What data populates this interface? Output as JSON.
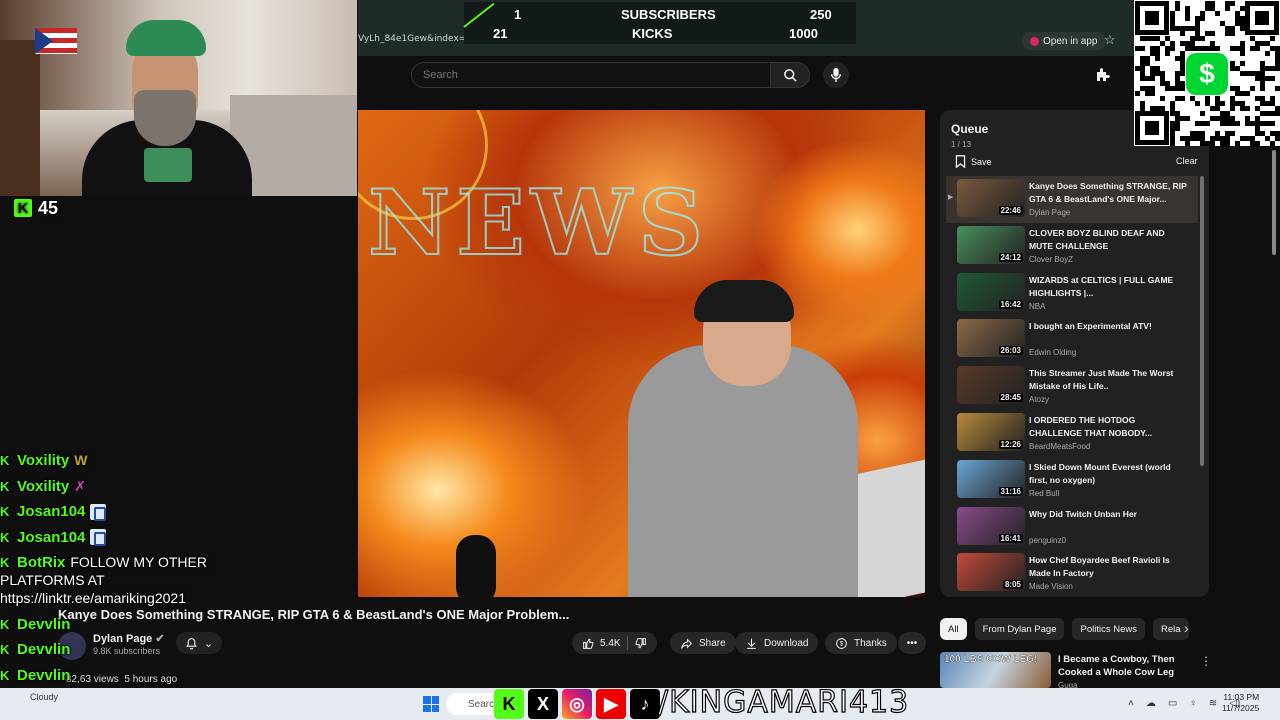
{
  "browser": {
    "url_fragment": "VyLh_84e1Gew&index=1",
    "open_in_app": "Open in app"
  },
  "scoreboard": {
    "row1": {
      "left": "1",
      "label": "SUBSCRIBERS",
      "right": "250"
    },
    "row2": {
      "left": "21",
      "label": "KICKS",
      "right": "1000"
    },
    "accent": "#53fc18"
  },
  "youtube": {
    "search_placeholder": "Search",
    "video_title": "Kanye Does Something STRANGE, RIP GTA 6 & BeastLand's ONE Major Problem...",
    "channel": "Dylan Page",
    "subscribers": "9.8K subscribers",
    "views": "82,63 views",
    "ago": "5 hours ago",
    "actions": {
      "likes": "5.4K",
      "share": "Share",
      "download": "Download",
      "thanks": "Thanks"
    },
    "queue": {
      "title": "Queue",
      "count": "1 / 13",
      "save": "Save",
      "clear": "Clear",
      "items": [
        {
          "title": "Kanye Does Something STRANGE, RIP GTA 6 & BeastLand's ONE Major...",
          "channel": "Dylan Page",
          "duration": "22:46",
          "thumb": "#7a5a3e",
          "current": true
        },
        {
          "title": "CLOVER BOYZ BLIND DEAF AND MUTE CHALLENGE",
          "channel": "Clover BoyZ",
          "duration": "24:12",
          "thumb": "#4a8f5e"
        },
        {
          "title": "WIZARDS at CELTICS | FULL GAME HIGHLIGHTS |...",
          "channel": "NBA",
          "duration": "16:42",
          "thumb": "#1f5a36"
        },
        {
          "title": "I bought an Experimental ATV!",
          "channel": "Edwin Olding",
          "duration": "26:03",
          "thumb": "#8a6a4a"
        },
        {
          "title": "This Streamer Just Made The Worst Mistake of His Life..",
          "channel": "Atozy",
          "duration": "28:45",
          "thumb": "#5a3a2a"
        },
        {
          "title": "I ORDERED THE HOTDOG CHALLENGE THAT NOBODY...",
          "channel": "BeardMeatsFood",
          "duration": "12:26",
          "thumb": "#b88a3a"
        },
        {
          "title": "I Skied Down Mount Everest (world first, no oxygen)",
          "channel": "Red Bull",
          "duration": "31:16",
          "thumb": "#6aa6d6"
        },
        {
          "title": "Why Did Twitch Unban Her",
          "channel": "penguinz0",
          "duration": "16:41",
          "thumb": "#8a4a8a"
        },
        {
          "title": "How Chef Boyardee Beef Ravioli Is Made In Factory",
          "channel": "Made Vision",
          "duration": "8:05",
          "thumb": "#c24a3a"
        }
      ]
    },
    "chips": [
      "All",
      "From Dylan Page",
      "Politics News",
      "Rela"
    ],
    "recommended": {
      "tag": "100 LBS COW LEG!",
      "title": "I Became a Cowboy, Then Cooked a Whole Cow Leg",
      "channel": "Guga"
    }
  },
  "stream": {
    "viewers": "45",
    "chat": [
      {
        "user": "Voxility",
        "text": "W"
      },
      {
        "user": "Voxility",
        "text": "✗"
      },
      {
        "user": "Josan104",
        "text": ""
      },
      {
        "user": "Josan104",
        "text": ""
      },
      {
        "user": "BotRix",
        "text": "FOLLOW MY OTHER"
      },
      {
        "user": "Devvlin",
        "text": ""
      },
      {
        "user": "Devvlin",
        "text": ""
      },
      {
        "user": "Devvlin",
        "text": ""
      }
    ],
    "chat_wrap1": "PLATFORMS AT",
    "chat_wrap2": "https://linktr.ee/amariking2021",
    "handle": "/KINGAMARI413",
    "qr_app": "$"
  },
  "taskbar": {
    "weather": "Cloudy",
    "search": "Search",
    "time": "11:03 PM",
    "date": "11/7/2025"
  }
}
